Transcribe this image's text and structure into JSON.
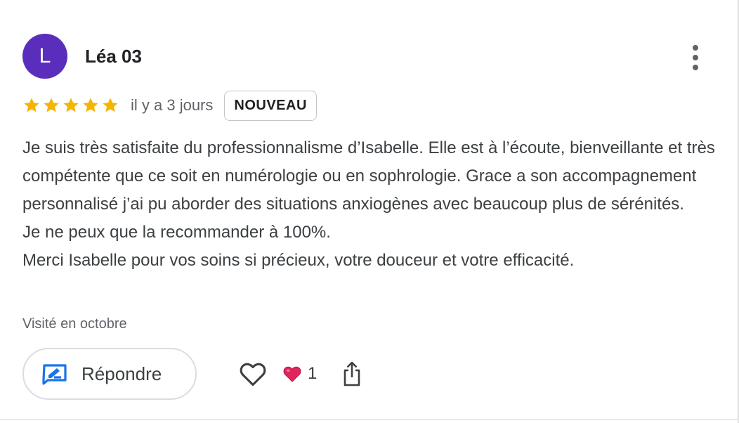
{
  "reviewer": {
    "initial": "L",
    "name": "Léa 03",
    "avatar_color": "#5b2dbd"
  },
  "menu": {
    "icon": "more-vert-icon"
  },
  "rating": {
    "stars": 5,
    "max": 5,
    "star_color": "#f4b400"
  },
  "date": "il y a 3 jours",
  "badge": "NOUVEAU",
  "review_lines": [
    "Je suis très satisfaite du professionnalisme d’Isabelle. Elle est à l’écoute, bienveillante et très compétente que ce soit en numérologie ou en sophrologie. Grace a son accompagnement personnalisé j’ai pu aborder des situations anxiogènes avec beaucoup plus de sérénités.",
    "Je ne peux que la recommander à 100%.",
    "Merci Isabelle pour vos soins si précieux, votre douceur et votre efficacité."
  ],
  "visited": "Visité en octobre",
  "actions": {
    "reply_label": "Répondre",
    "reply_icon": "reply-edit-icon",
    "like_icon": "heart-outline-icon",
    "reaction_icon": "red-heart-icon",
    "reaction_count": "1",
    "share_icon": "share-icon",
    "accent_color": "#1a73e8"
  }
}
